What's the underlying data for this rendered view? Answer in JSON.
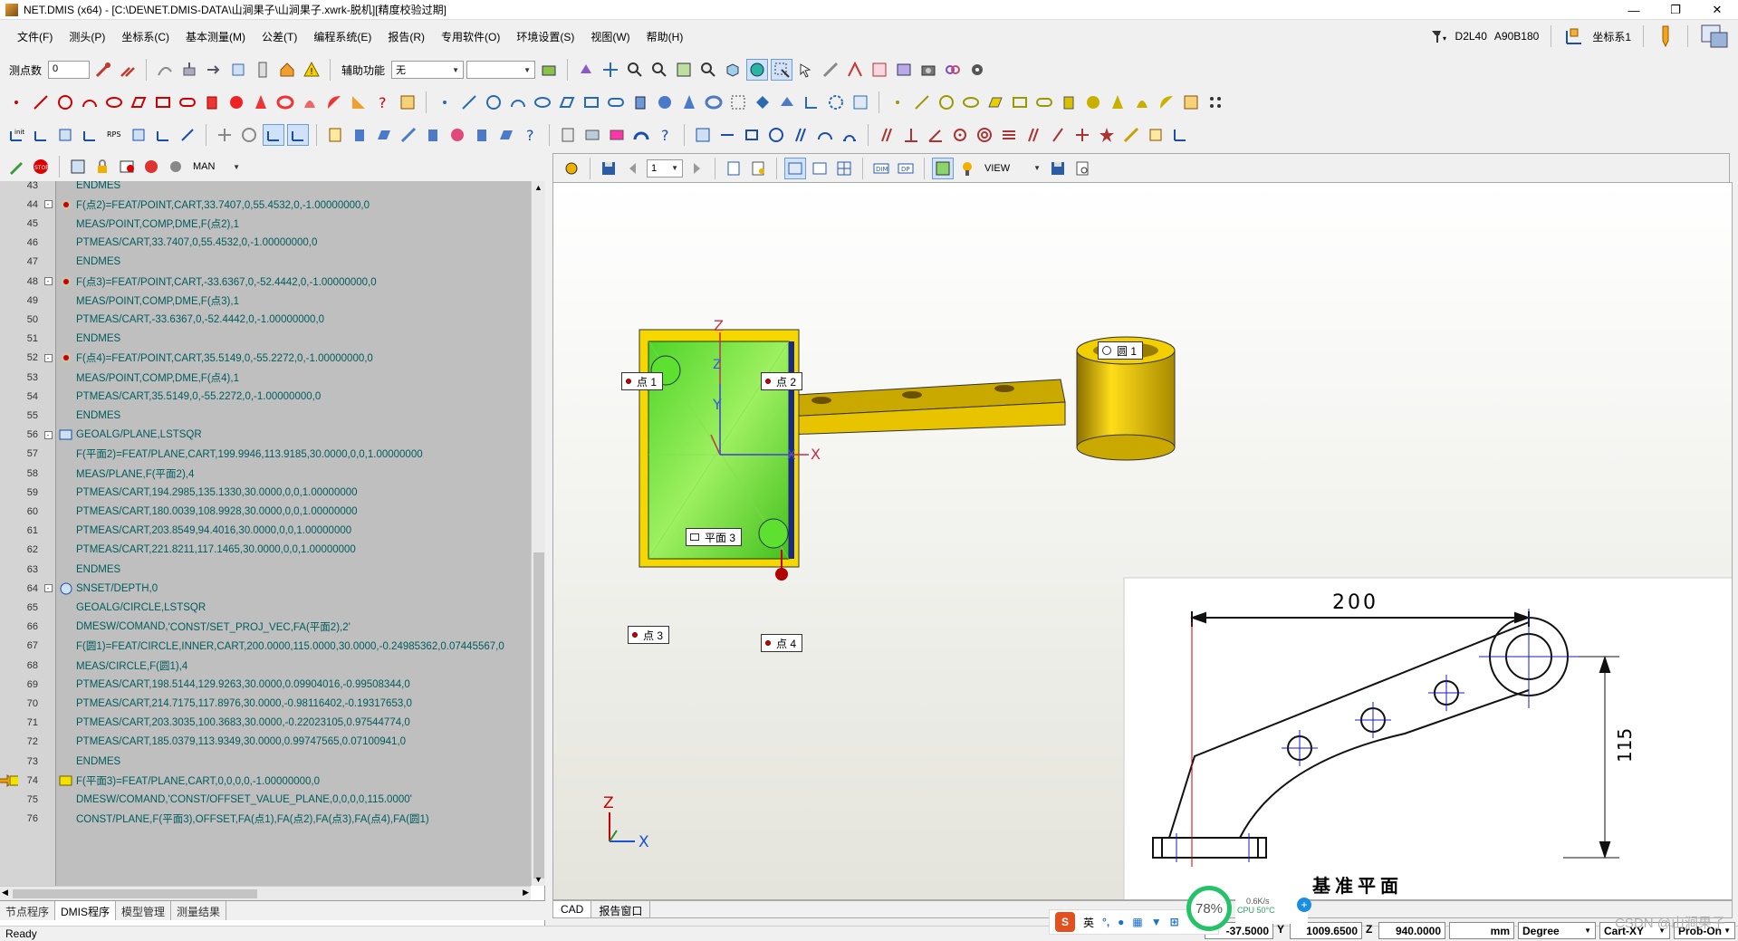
{
  "title": "NET.DMIS (x64) - [C:\\DE\\NET.DMIS-DATA\\山涧果子\\山涧果子.xwrk-脱机][精度校验过期]",
  "window_controls": {
    "minimize": "—",
    "restore": "❐",
    "close": "✕"
  },
  "menu": [
    "文件(F)",
    "测头(P)",
    "坐标系(C)",
    "基本测量(M)",
    "公差(T)",
    "编程系统(E)",
    "报告(R)",
    "专用软件(O)",
    "环境设置(S)",
    "视图(W)",
    "帮助(H)"
  ],
  "status_right": {
    "probe": "D2L40",
    "angles": "A90B180",
    "coord_label": "坐标系1"
  },
  "toolbar1": {
    "points_label": "测点数",
    "points_value": "0",
    "aux_label": "辅助功能",
    "aux_value": "无",
    "aux_value2": ""
  },
  "toolbar4": {
    "mode": "MAN"
  },
  "view_toolbar": {
    "page": "1",
    "view": "VIEW"
  },
  "code_lines": [
    {
      "n": "43",
      "fold": "",
      "icon": "",
      "text": "ENDMES",
      "indent": 1
    },
    {
      "n": "44",
      "fold": "-",
      "icon": "point",
      "text": "F(点2)=FEAT/POINT,CART,33.7407,0,55.4532,0,-1.00000000,0",
      "indent": 0
    },
    {
      "n": "45",
      "fold": "",
      "icon": "",
      "text": "MEAS/POINT,COMP,DME,F(点2),1",
      "indent": 1
    },
    {
      "n": "46",
      "fold": "",
      "icon": "",
      "text": "PTMEAS/CART,33.7407,0,55.4532,0,-1.00000000,0",
      "indent": 1
    },
    {
      "n": "47",
      "fold": "",
      "icon": "",
      "text": "ENDMES",
      "indent": 1
    },
    {
      "n": "48",
      "fold": "-",
      "icon": "point",
      "text": "F(点3)=FEAT/POINT,CART,-33.6367,0,-52.4442,0,-1.00000000,0",
      "indent": 0
    },
    {
      "n": "49",
      "fold": "",
      "icon": "",
      "text": "MEAS/POINT,COMP,DME,F(点3),1",
      "indent": 1
    },
    {
      "n": "50",
      "fold": "",
      "icon": "",
      "text": "PTMEAS/CART,-33.6367,0,-52.4442,0,-1.00000000,0",
      "indent": 1
    },
    {
      "n": "51",
      "fold": "",
      "icon": "",
      "text": "ENDMES",
      "indent": 1
    },
    {
      "n": "52",
      "fold": "-",
      "icon": "point",
      "text": "F(点4)=FEAT/POINT,CART,35.5149,0,-55.2272,0,-1.00000000,0",
      "indent": 0
    },
    {
      "n": "53",
      "fold": "",
      "icon": "",
      "text": "MEAS/POINT,COMP,DME,F(点4),1",
      "indent": 1
    },
    {
      "n": "54",
      "fold": "",
      "icon": "",
      "text": "PTMEAS/CART,35.5149,0,-55.2272,0,-1.00000000,0",
      "indent": 1
    },
    {
      "n": "55",
      "fold": "",
      "icon": "",
      "text": "ENDMES",
      "indent": 1
    },
    {
      "n": "56",
      "fold": "-",
      "icon": "plane",
      "text": "GEOALG/PLANE,LSTSQR",
      "indent": 0
    },
    {
      "n": "57",
      "fold": "",
      "icon": "",
      "text": "F(平面2)=FEAT/PLANE,CART,199.9946,113.9185,30.0000,0,0,1.00000000",
      "indent": 1
    },
    {
      "n": "58",
      "fold": "",
      "icon": "",
      "text": "MEAS/PLANE,F(平面2),4",
      "indent": 1
    },
    {
      "n": "59",
      "fold": "",
      "icon": "",
      "text": "PTMEAS/CART,194.2985,135.1330,30.0000,0,0,1.00000000",
      "indent": 1
    },
    {
      "n": "60",
      "fold": "",
      "icon": "",
      "text": "PTMEAS/CART,180.0039,108.9928,30.0000,0,0,1.00000000",
      "indent": 1
    },
    {
      "n": "61",
      "fold": "",
      "icon": "",
      "text": "PTMEAS/CART,203.8549,94.4016,30.0000,0,0,1.00000000",
      "indent": 1
    },
    {
      "n": "62",
      "fold": "",
      "icon": "",
      "text": "PTMEAS/CART,221.8211,117.1465,30.0000,0,0,1.00000000",
      "indent": 1
    },
    {
      "n": "63",
      "fold": "",
      "icon": "",
      "text": "ENDMES",
      "indent": 1
    },
    {
      "n": "64",
      "fold": "-",
      "icon": "circle",
      "text": "SNSET/DEPTH,0",
      "indent": 0
    },
    {
      "n": "65",
      "fold": "",
      "icon": "",
      "text": "GEOALG/CIRCLE,LSTSQR",
      "indent": 1
    },
    {
      "n": "66",
      "fold": "",
      "icon": "",
      "text": "DMESW/COMAND,",
      "red": "'CONST/SET_PROJ_VEC,FA(平面2),2'",
      "indent": 1
    },
    {
      "n": "67",
      "fold": "",
      "icon": "",
      "text": "F(圆1)=FEAT/CIRCLE,INNER,CART,200.0000,115.0000,30.0000,-0.24985362,0.07445567,0",
      "indent": 1
    },
    {
      "n": "68",
      "fold": "",
      "icon": "",
      "text": "MEAS/CIRCLE,F(圆1),4",
      "indent": 1
    },
    {
      "n": "69",
      "fold": "",
      "icon": "",
      "text": "PTMEAS/CART,198.5144,129.9263,30.0000,0.09904016,-0.99508344,0",
      "indent": 1
    },
    {
      "n": "70",
      "fold": "",
      "icon": "",
      "text": "PTMEAS/CART,214.7175,117.8976,30.0000,-0.98116402,-0.19317653,0",
      "indent": 1
    },
    {
      "n": "71",
      "fold": "",
      "icon": "",
      "text": "PTMEAS/CART,203.3035,100.3683,30.0000,-0.22023105,0.97544774,0",
      "indent": 1
    },
    {
      "n": "72",
      "fold": "",
      "icon": "",
      "text": "PTMEAS/CART,185.0379,113.9349,30.0000,0.99747565,0.07100941,0",
      "indent": 1
    },
    {
      "n": "73",
      "fold": "",
      "icon": "",
      "text": "ENDMES",
      "indent": 1
    },
    {
      "n": "74",
      "fold": "",
      "icon": "plane-yellow",
      "text": "F(平面3)=FEAT/PLANE,CART,0,0,0,0,-1.00000000,0",
      "indent": 0,
      "arrow": true
    },
    {
      "n": "75",
      "fold": "",
      "icon": "",
      "text": "DMESW/COMAND,",
      "red": "'CONST/OFFSET_VALUE_PLANE,0,0,0,0,115.0000'",
      "indent": 1
    },
    {
      "n": "76",
      "fold": "",
      "icon": "",
      "text": "CONST/PLANE,F(平面3),OFFSET,FA(点1),FA(点2),FA(点3),FA(点4),FA(圆1)",
      "indent": 1
    }
  ],
  "left_tabs": [
    "节点程序",
    "DMIS程序",
    "模型管理",
    "测量结果"
  ],
  "left_active_tab": "DMIS程序",
  "cad_labels": {
    "p1": "点 1",
    "p2": "点 2",
    "p3": "点 3",
    "p4": "点 4",
    "plane3": "平面 3",
    "circle1": "圆 1"
  },
  "axis_labels": {
    "z": "Z",
    "x": "X",
    "y": "Y"
  },
  "drawing": {
    "dim_h": "200",
    "dim_v": "115",
    "caption": "基准平面"
  },
  "bottom_tabs": [
    "CAD",
    "报告窗口"
  ],
  "status": {
    "ready": "Ready",
    "x_value": "-37.5000",
    "y_label": "Y",
    "y_value": "1009.6500",
    "z_label": "Z",
    "z_value": "940.0000",
    "unit": "mm",
    "angle_unit": "Degree",
    "plane": "Cart-XY",
    "probe_state": "Prob-On"
  },
  "ime": {
    "logo": "S",
    "lang": "英"
  },
  "cpu": {
    "percent": "78%",
    "speed": "0.6K/s",
    "cpu_label": "CPU 50°C",
    "plus": "+"
  },
  "watermark": "CSDN @山涧果子",
  "colors": {
    "code_text": "#005c5c",
    "code_string": "#c00000",
    "editor_bg": "#bfbfbf",
    "part_yellow": "#e8c400",
    "plane_green": "#66dd22"
  }
}
